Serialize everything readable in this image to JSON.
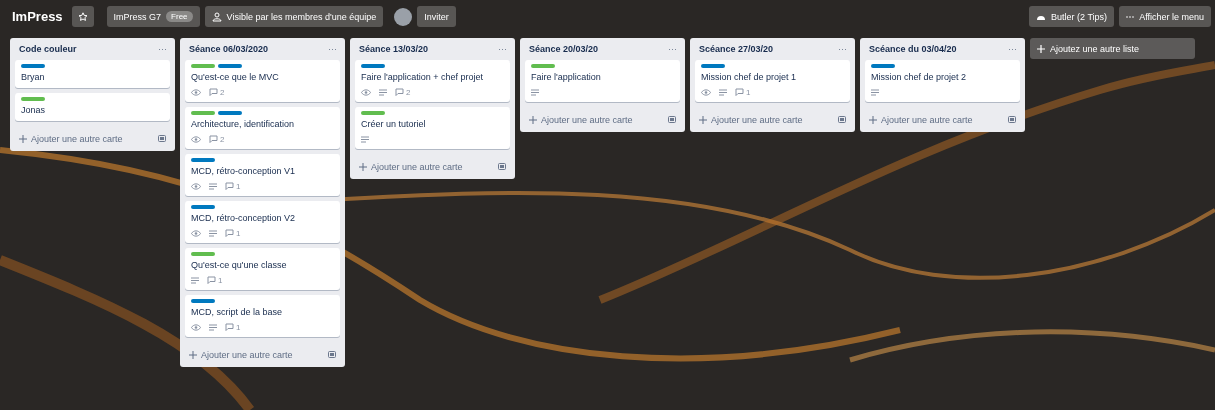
{
  "header": {
    "board_name": "ImPress",
    "team": "ImPress G7",
    "team_badge": "Free",
    "visibility": "Visible par les membres d'une équipe",
    "invite": "Inviter",
    "butler": "Butler (2 Tips)",
    "menu": "Afficher le menu"
  },
  "lists": [
    {
      "title": "Code couleur",
      "menu": "···",
      "add_card": "Ajouter une autre carte",
      "cards": [
        {
          "title": "Bryan",
          "labels": [
            {
              "color": "#0079bf"
            }
          ],
          "watching": false,
          "description": false
        },
        {
          "title": "Jonas",
          "labels": [
            {
              "color": "#61bd4f"
            }
          ],
          "watching": false,
          "description": false
        }
      ]
    },
    {
      "title": "Séance 06/03/2020",
      "menu": "···",
      "add_card": "Ajouter une autre carte",
      "cards": [
        {
          "title": "Qu'est-ce que le MVC",
          "labels": [
            {
              "color": "#61bd4f"
            },
            {
              "color": "#0079bf"
            }
          ],
          "watching": true,
          "description": false,
          "comments": "2"
        },
        {
          "title": "Architecture, identification",
          "labels": [
            {
              "color": "#61bd4f"
            },
            {
              "color": "#0079bf"
            }
          ],
          "watching": true,
          "description": false,
          "comments": "2"
        },
        {
          "title": "MCD, rétro-conception V1",
          "labels": [
            {
              "color": "#0079bf"
            }
          ],
          "watching": true,
          "description": true,
          "comments": "1"
        },
        {
          "title": "MCD, rétro-conception V2",
          "labels": [
            {
              "color": "#0079bf"
            }
          ],
          "watching": true,
          "description": true,
          "comments": "1"
        },
        {
          "title": "Qu'est-ce qu'une classe",
          "labels": [
            {
              "color": "#61bd4f"
            }
          ],
          "watching": false,
          "description": true,
          "comments": "1"
        },
        {
          "title": "MCD, script de la base",
          "labels": [
            {
              "color": "#0079bf"
            }
          ],
          "watching": true,
          "description": true,
          "comments": "1"
        }
      ]
    },
    {
      "title": "Séance 13/03/20",
      "menu": "···",
      "add_card": "Ajouter une autre carte",
      "cards": [
        {
          "title": "Faire l'application + chef projet",
          "labels": [
            {
              "color": "#0079bf"
            }
          ],
          "watching": true,
          "description": true,
          "comments": "2"
        },
        {
          "title": "Créer un tutoriel",
          "labels": [
            {
              "color": "#61bd4f"
            }
          ],
          "watching": false,
          "description": true
        }
      ]
    },
    {
      "title": "Séance 20/03/20",
      "menu": "···",
      "add_card": "Ajouter une autre carte",
      "cards": [
        {
          "title": "Faire l'application",
          "labels": [
            {
              "color": "#61bd4f"
            }
          ],
          "watching": false,
          "description": true
        }
      ]
    },
    {
      "title": "Scéance 27/03/20",
      "menu": "···",
      "add_card": "Ajouter une autre carte",
      "cards": [
        {
          "title": "Mission chef de projet 1",
          "labels": [
            {
              "color": "#0079bf"
            }
          ],
          "watching": true,
          "description": true,
          "comments": "1"
        }
      ]
    },
    {
      "title": "Scéance du 03/04/20",
      "menu": "···",
      "add_card": "Ajouter une autre carte",
      "cards": [
        {
          "title": "Mission chef de projet 2",
          "labels": [
            {
              "color": "#0079bf"
            }
          ],
          "watching": false,
          "description": true
        }
      ]
    }
  ],
  "add_list": "Ajoutez une autre liste"
}
